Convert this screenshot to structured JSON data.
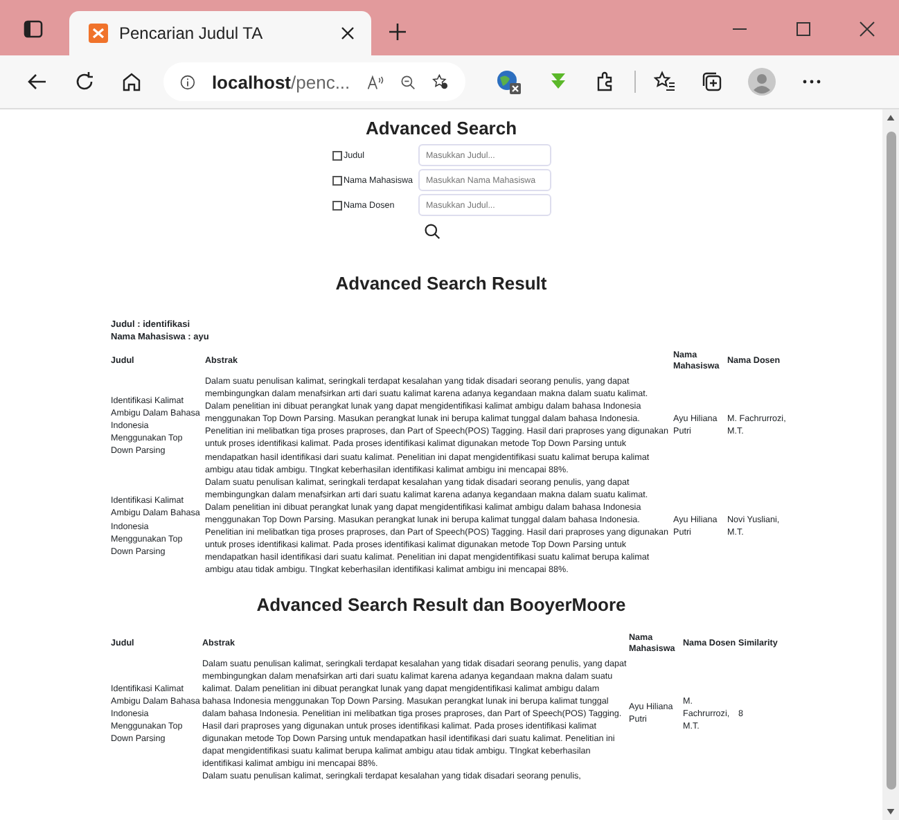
{
  "browser": {
    "tab_title": "Pencarian Judul TA",
    "address_host": "localhost",
    "address_path": "/penc..."
  },
  "search": {
    "title": "Advanced Search",
    "fields": [
      {
        "label": "Judul",
        "checked": false,
        "placeholder": "Masukkan Judul..."
      },
      {
        "label": "Nama Mahasiswa",
        "checked": false,
        "placeholder": "Masukkan Nama Mahasiswa"
      },
      {
        "label": "Nama Dosen",
        "checked": false,
        "placeholder": "Masukkan Judul..."
      }
    ]
  },
  "result": {
    "title": "Advanced Search Result",
    "query": [
      "Judul : identifikasi",
      "Nama Mahasiswa : ayu"
    ],
    "columns": [
      "Judul",
      "Abstrak",
      "Nama Mahasiswa",
      "Nama Dosen"
    ],
    "rows": [
      {
        "judul": "Identifikasi Kalimat Ambigu Dalam Bahasa Indonesia Menggunakan Top Down Parsing",
        "abstrak": "Dalam suatu penulisan kalimat, seringkali terdapat kesalahan yang tidak disadari seorang penulis, yang dapat membingungkan dalam menafsirkan arti dari suatu kalimat karena adanya kegandaan makna dalam suatu kalimat. Dalam penelitian ini dibuat perangkat lunak yang dapat mengidentifikasi kalimat ambigu dalam bahasa Indonesia menggunakan Top Down Parsing. Masukan perangkat lunak ini berupa kalimat tunggal dalam bahasa Indonesia. Penelitian ini melibatkan tiga proses praproses, dan Part of Speech(POS) Tagging. Hasil dari praproses yang digunakan untuk proses identifikasi kalimat. Pada proses identifikasi kalimat digunakan metode Top Down Parsing untuk mendapatkan hasil identifikasi dari suatu kalimat. Penelitian ini dapat mengidentifikasi suatu kalimat berupa kalimat ambigu atau tidak ambigu. TIngkat keberhasilan identifikasi kalimat ambigu ini mencapai 88%.",
        "mahasiswa": "Ayu Hiliana Putri",
        "dosen": "M. Fachrurrozi, M.T."
      },
      {
        "judul": "Identifikasi Kalimat Ambigu Dalam Bahasa Indonesia Menggunakan Top Down Parsing",
        "abstrak": "Dalam suatu penulisan kalimat, seringkali terdapat kesalahan yang tidak disadari seorang penulis, yang dapat membingungkan dalam menafsirkan arti dari suatu kalimat karena adanya kegandaan makna dalam suatu kalimat. Dalam penelitian ini dibuat perangkat lunak yang dapat mengidentifikasi kalimat ambigu dalam bahasa Indonesia menggunakan Top Down Parsing. Masukan perangkat lunak ini berupa kalimat tunggal dalam bahasa Indonesia. Penelitian ini melibatkan tiga proses praproses, dan Part of Speech(POS) Tagging. Hasil dari praproses yang digunakan untuk proses identifikasi kalimat. Pada proses identifikasi kalimat digunakan metode Top Down Parsing untuk mendapatkan hasil identifikasi dari suatu kalimat. Penelitian ini dapat mengidentifikasi suatu kalimat berupa kalimat ambigu atau tidak ambigu. TIngkat keberhasilan identifikasi kalimat ambigu ini mencapai 88%.",
        "mahasiswa": "Ayu Hiliana Putri",
        "dosen": "Novi Yusliani, M.T."
      }
    ]
  },
  "bm_result": {
    "title": "Advanced Search Result dan BooyerMoore",
    "columns": [
      "Judul",
      "Abstrak",
      "Nama Mahasiswa",
      "Nama Dosen",
      "Similarity"
    ],
    "rows": [
      {
        "judul": "Identifikasi Kalimat Ambigu Dalam Bahasa Indonesia Menggunakan Top Down Parsing",
        "abstrak": "Dalam suatu penulisan kalimat, seringkali terdapat kesalahan yang tidak disadari seorang penulis, yang dapat membingungkan dalam menafsirkan arti dari suatu kalimat karena adanya kegandaan makna dalam suatu kalimat. Dalam penelitian ini dibuat perangkat lunak yang dapat mengidentifikasi kalimat ambigu dalam bahasa Indonesia menggunakan Top Down Parsing. Masukan perangkat lunak ini berupa kalimat tunggal dalam bahasa Indonesia. Penelitian ini melibatkan tiga proses praproses, dan Part of Speech(POS) Tagging. Hasil dari praproses yang digunakan untuk proses identifikasi kalimat. Pada proses identifikasi kalimat digunakan metode Top Down Parsing untuk mendapatkan hasil identifikasi dari suatu kalimat. Penelitian ini dapat mengidentifikasi suatu kalimat berupa kalimat ambigu atau tidak ambigu. TIngkat keberhasilan identifikasi kalimat ambigu ini mencapai 88%.",
        "mahasiswa": "Ayu Hiliana Putri",
        "dosen": "M. Fachrurrozi, M.T.",
        "similarity": "8"
      },
      {
        "abstrak": "Dalam suatu penulisan kalimat, seringkali terdapat kesalahan yang tidak disadari seorang penulis,"
      }
    ]
  }
}
